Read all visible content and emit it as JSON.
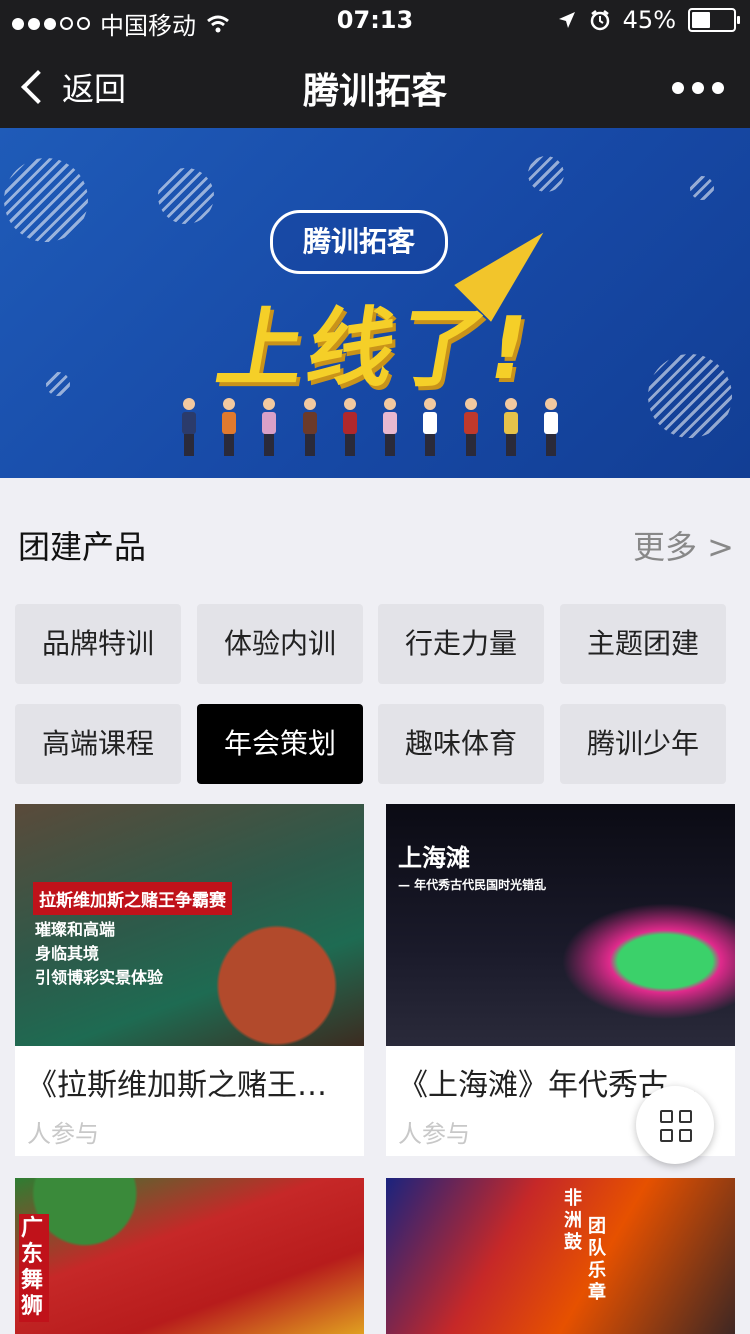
{
  "status_bar": {
    "carrier": "中国移动",
    "time": "07:13",
    "battery": "45%",
    "battery_level": 0.45,
    "icons": [
      "signal-dots",
      "wifi-icon",
      "location-icon",
      "alarm-icon",
      "battery-icon"
    ]
  },
  "nav": {
    "back_label": "返回",
    "title": "腾训拓客"
  },
  "banner": {
    "pill_text": "腾训拓客",
    "headline": "上线了!"
  },
  "section": {
    "title": "团建产品",
    "more_label": "更多 >"
  },
  "categories": [
    {
      "label": "品牌特训",
      "active": false
    },
    {
      "label": "体验内训",
      "active": false
    },
    {
      "label": "行走力量",
      "active": false
    },
    {
      "label": "主题团建",
      "active": false
    },
    {
      "label": "高端课程",
      "active": false
    },
    {
      "label": "年会策划",
      "active": true
    },
    {
      "label": "趣味体育",
      "active": false
    },
    {
      "label": "腾训少年",
      "active": false
    }
  ],
  "products": [
    {
      "title": "《拉斯维加斯之赌王…",
      "sub": "人参与",
      "image_caption": "拉斯维加斯之赌王争霸赛",
      "image_lines": [
        "璀璨和高端",
        "身临其境",
        "引领博彩实景体验"
      ]
    },
    {
      "title": "《上海滩》年代秀古…",
      "sub": "人参与",
      "image_caption": "上海滩",
      "image_subcaption": "— 年代秀古代民国时光错乱"
    },
    {
      "title": "",
      "sub": "",
      "image_caption": "广东舞狮"
    },
    {
      "title": "",
      "sub": "",
      "image_caption": "非洲鼓",
      "image_caption2": "团队乐章"
    }
  ],
  "colors": {
    "nav_bg": "#1d1d1f",
    "banner_blue": "#1749a6",
    "headline_yellow": "#f5cf28",
    "active_chip": "#000000"
  }
}
